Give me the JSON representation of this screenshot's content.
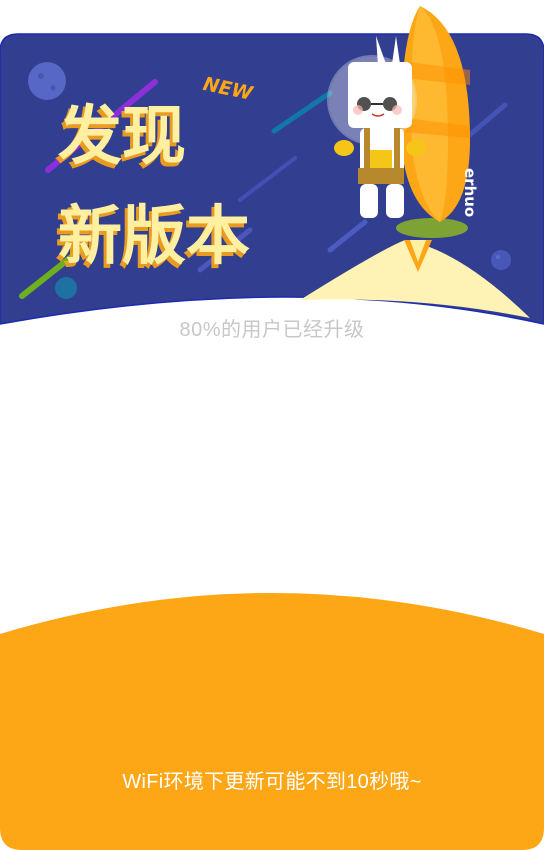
{
  "header": {
    "badge": "NEW",
    "title_line1": "发现",
    "title_line2": "新版本",
    "mascot_label": "erhuo"
  },
  "subtitle": "80%的用户已经升级",
  "footer": {
    "hint": "WiFi环境下更新可能不到10秒哦~"
  },
  "colors": {
    "banner_bg": "#323e8f",
    "accent_orange": "#fda616",
    "title_yellow": "#fef0a0",
    "subtitle_gray": "#c7c7c7"
  }
}
